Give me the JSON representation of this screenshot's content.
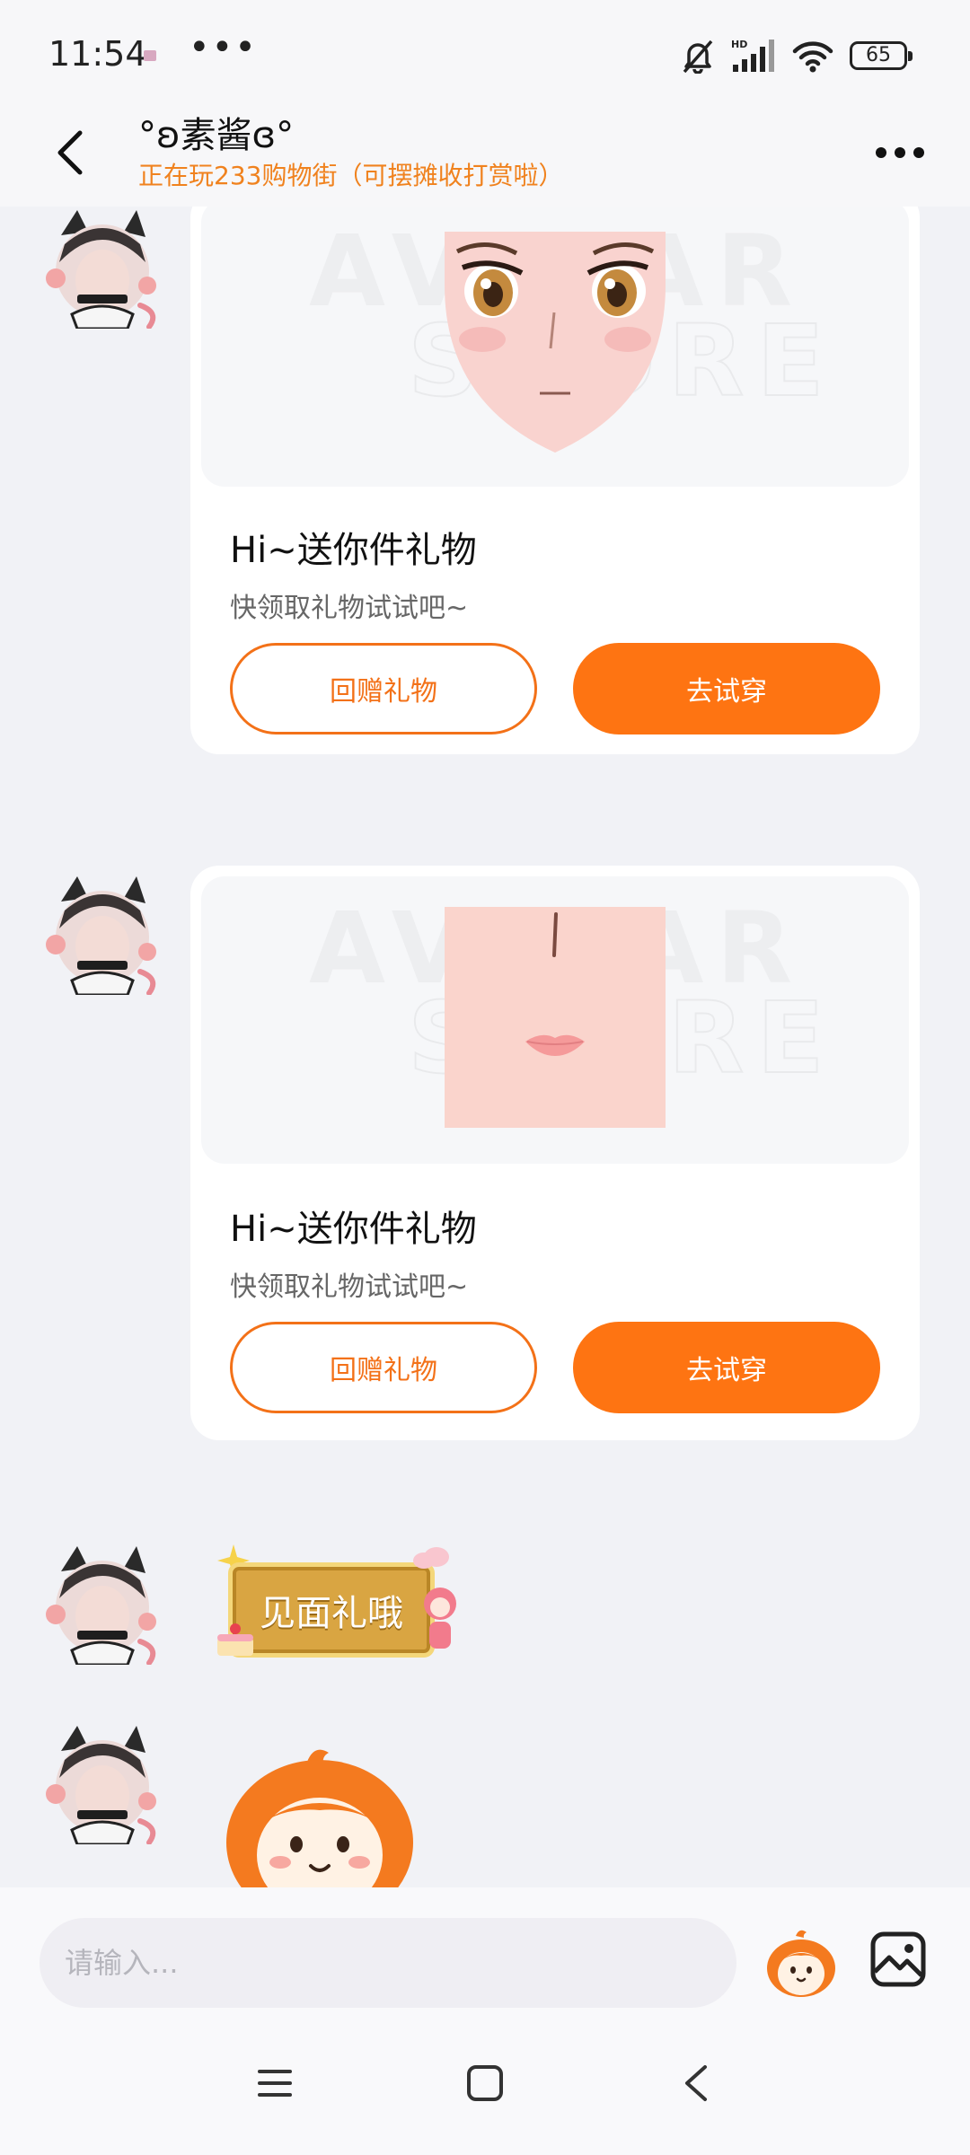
{
  "status_bar": {
    "time": "11:54",
    "more": "•••",
    "network": "HD",
    "battery": "65"
  },
  "header": {
    "back_icon": "chevron-left-icon",
    "name": "°ʚ素酱ɞ°",
    "status": "正在玩233购物街（可摆摊收打赏啦）",
    "more_icon": "more-horizontal-icon"
  },
  "chat": {
    "messages": [
      {
        "type": "gift_card",
        "image_desc_icon": "face-eyes-icon",
        "title": "Hi~送你件礼物",
        "subtitle": "快领取礼物试试吧~",
        "secondary_button": "回赠礼物",
        "primary_button": "去试穿"
      },
      {
        "type": "gift_card",
        "image_desc_icon": "face-mouth-icon",
        "title": "Hi~送你件礼物",
        "subtitle": "快领取礼物试试吧~",
        "secondary_button": "回赠礼物",
        "primary_button": "去试穿"
      },
      {
        "type": "sticker",
        "text": "见面礼哦"
      },
      {
        "type": "sticker",
        "icon": "mascot-sticker-icon"
      }
    ]
  },
  "input_bar": {
    "placeholder": "请输入...",
    "emoji_icon": "mascot-emoji-icon",
    "image_icon": "image-icon"
  },
  "nav_bar": {
    "menu_icon": "menu-icon",
    "home_icon": "home-square-icon",
    "back_icon": "back-triangle-icon"
  },
  "colors": {
    "accent": "#fe7412",
    "accent_text": "#f0821e",
    "background": "#f1f2f6"
  }
}
